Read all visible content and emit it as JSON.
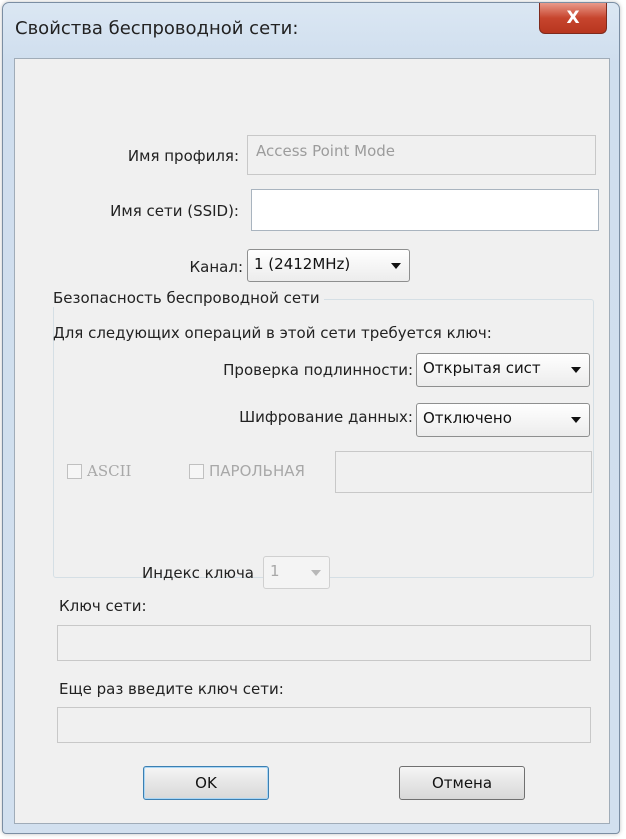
{
  "window": {
    "title": "Свойства беспроводной сети:",
    "close_label": "X"
  },
  "form": {
    "profile_name_label": "Имя профиля:",
    "profile_name_value": "Access Point Mode",
    "ssid_label": "Имя сети (SSID):",
    "ssid_value": "",
    "channel_label": "Канал:",
    "channel_value": "1 (2412MHz)"
  },
  "security": {
    "group_title": "Безопасность беспроводной сети",
    "description": "Для следующих операций в этой сети требуется ключ:",
    "auth_label": "Проверка подлинности:",
    "auth_value": "Открытая сист",
    "encryption_label": "Шифрование данных:",
    "encryption_value": "Отключено",
    "ascii_label": "ASCII",
    "passphrase_label": "ПАРОЛЬНАЯ",
    "passphrase_value": "",
    "key_index_label": "Индекс ключа",
    "key_index_value": "1",
    "network_key_label": "Ключ сети:",
    "network_key_value": "",
    "confirm_key_label": "Еще раз введите ключ сети:",
    "confirm_key_value": ""
  },
  "buttons": {
    "ok_label": "OK",
    "cancel_label": "Отмена"
  }
}
